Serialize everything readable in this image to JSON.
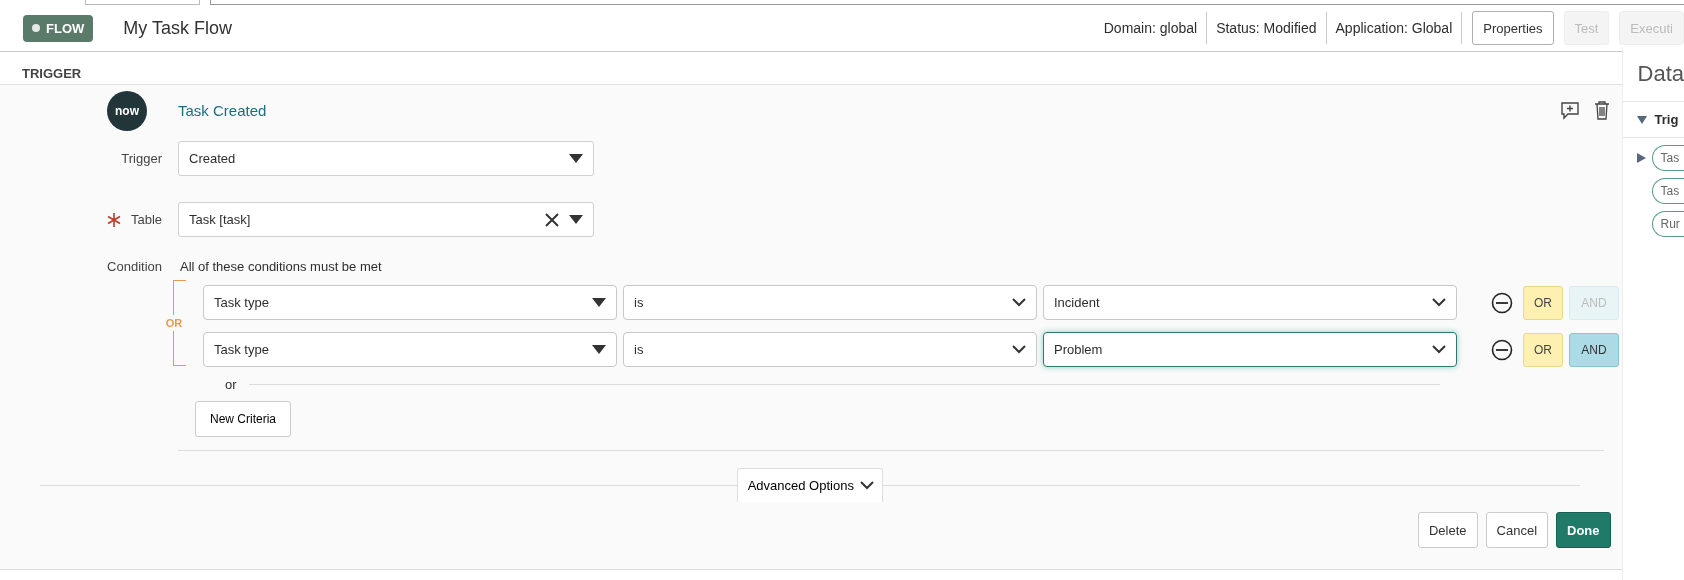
{
  "header": {
    "badge": "FLOW",
    "title": "My Task Flow",
    "meta": [
      "Domain: global",
      "Status: Modified",
      "Application: Global"
    ],
    "buttons": [
      {
        "label": "Properties",
        "disabled": false
      },
      {
        "label": "Test",
        "disabled": true
      },
      {
        "label": "Executi",
        "disabled": true
      }
    ]
  },
  "section_title": "TRIGGER",
  "trigger": {
    "logo": "now",
    "title": "Task Created",
    "fields": [
      {
        "label": "Trigger",
        "value": "Created",
        "required": false,
        "clearable": false
      },
      {
        "label": "Table",
        "value": "Task [task]",
        "required": true,
        "clearable": true
      }
    ],
    "condition": {
      "label": "Condition",
      "description": "All of these conditions must be met",
      "group_label": "OR",
      "rows": [
        {
          "field": "Task type",
          "operator": "is",
          "value": "Incident",
          "focused": false,
          "or_label": "OR",
          "and_label": "AND",
          "and_enabled": false
        },
        {
          "field": "Task type",
          "operator": "is",
          "value": "Problem",
          "focused": true,
          "or_label": "OR",
          "and_label": "AND",
          "and_enabled": true
        }
      ],
      "separator": "or",
      "new_criteria": "New Criteria"
    },
    "advanced": "Advanced Options",
    "footer": [
      {
        "label": "Delete",
        "primary": false
      },
      {
        "label": "Cancel",
        "primary": false
      },
      {
        "label": "Done",
        "primary": true
      }
    ]
  },
  "side_panel": {
    "title": "Data",
    "section": "Trig",
    "expanded": true,
    "pills": [
      {
        "label": "Tas",
        "expandable": true
      },
      {
        "label": "Tas",
        "expandable": false
      },
      {
        "label": "Rur",
        "expandable": false
      }
    ]
  }
}
